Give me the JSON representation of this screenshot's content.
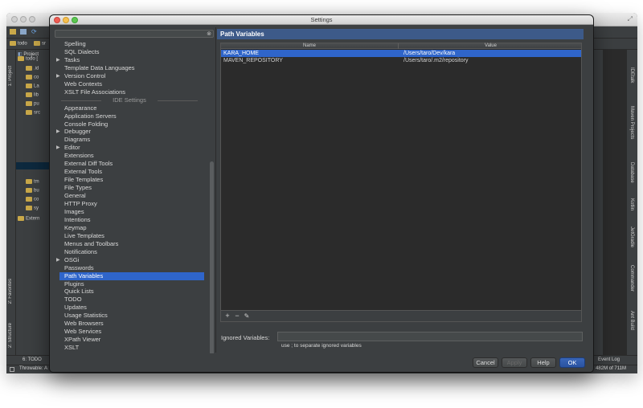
{
  "window": {
    "title": "Settings"
  },
  "search": {
    "placeholder": ""
  },
  "ide": {
    "project_tab": "Project",
    "todo_tab": "6: TODO",
    "status_text": "Throwable: A",
    "event_log": "Event Log",
    "memory": "482M of 711M",
    "tabs": [
      "todo",
      "sr"
    ],
    "left_tabs": [
      "1: Project",
      "2: Favorites",
      "2: Structure"
    ],
    "right_tabs": [
      "IDEtalk",
      "Maven Projects",
      "Database",
      "Kotlin",
      "JetGradle",
      "Commander",
      "Ant Build"
    ],
    "tree": [
      {
        "label": "todo [",
        "indent": 0
      },
      {
        "label": ".id",
        "indent": 1
      },
      {
        "label": "co",
        "indent": 1
      },
      {
        "label": "La",
        "indent": 1
      },
      {
        "label": "lib",
        "indent": 1
      },
      {
        "label": "pu",
        "indent": 1
      },
      {
        "label": "src",
        "indent": 1
      },
      {
        "label": "tm",
        "indent": 1
      },
      {
        "label": "bu",
        "indent": 1
      },
      {
        "label": "co",
        "indent": 1
      },
      {
        "label": "sy",
        "indent": 1
      },
      {
        "label": "Extern",
        "indent": 0
      }
    ]
  },
  "settings_tree": {
    "items": [
      {
        "label": "Spelling",
        "arrow": false
      },
      {
        "label": "SQL Dialects",
        "arrow": false
      },
      {
        "label": "Tasks",
        "arrow": true
      },
      {
        "label": "Template Data Languages",
        "arrow": false
      },
      {
        "label": "Version Control",
        "arrow": true
      },
      {
        "label": "Web Contexts",
        "arrow": false
      },
      {
        "label": "XSLT File Associations",
        "arrow": false
      }
    ],
    "ide_header": "IDE Settings",
    "ide_items": [
      {
        "label": "Appearance",
        "arrow": false
      },
      {
        "label": "Application Servers",
        "arrow": false
      },
      {
        "label": "Console Folding",
        "arrow": false
      },
      {
        "label": "Debugger",
        "arrow": true
      },
      {
        "label": "Diagrams",
        "arrow": false
      },
      {
        "label": "Editor",
        "arrow": true
      },
      {
        "label": "Extensions",
        "arrow": false
      },
      {
        "label": "External Diff Tools",
        "arrow": false
      },
      {
        "label": "External Tools",
        "arrow": false
      },
      {
        "label": "File Templates",
        "arrow": false
      },
      {
        "label": "File Types",
        "arrow": false
      },
      {
        "label": "General",
        "arrow": false
      },
      {
        "label": "HTTP Proxy",
        "arrow": false
      },
      {
        "label": "Images",
        "arrow": false
      },
      {
        "label": "Intentions",
        "arrow": false
      },
      {
        "label": "Keymap",
        "arrow": false
      },
      {
        "label": "Live Templates",
        "arrow": false
      },
      {
        "label": "Menus and Toolbars",
        "arrow": false
      },
      {
        "label": "Notifications",
        "arrow": false
      },
      {
        "label": "OSGi",
        "arrow": true
      },
      {
        "label": "Passwords",
        "arrow": false
      },
      {
        "label": "Path Variables",
        "arrow": false,
        "selected": true
      },
      {
        "label": "Plugins",
        "arrow": false
      },
      {
        "label": "Quick Lists",
        "arrow": false
      },
      {
        "label": "TODO",
        "arrow": false
      },
      {
        "label": "Updates",
        "arrow": false
      },
      {
        "label": "Usage Statistics",
        "arrow": false
      },
      {
        "label": "Web Browsers",
        "arrow": false
      },
      {
        "label": "Web Services",
        "arrow": false
      },
      {
        "label": "XPath Viewer",
        "arrow": false
      },
      {
        "label": "XSLT",
        "arrow": false
      }
    ]
  },
  "panel": {
    "title": "Path Variables",
    "columns": [
      "Name",
      "Value"
    ],
    "rows": [
      {
        "name": "KARA_HOME",
        "value": "/Users/taro/Dev/kara",
        "selected": true
      },
      {
        "name": "MAVEN_REPOSITORY",
        "value": "/Users/taro/.m2/repository",
        "selected": false
      }
    ],
    "tools": {
      "add": "+",
      "remove": "−",
      "edit": "✎"
    },
    "ignored_label": "Ignored Variables:",
    "ignored_value": "",
    "ignored_hint": "use ; to separate ignored variables"
  },
  "buttons": {
    "cancel": "Cancel",
    "apply": "Apply",
    "help": "Help",
    "ok": "OK"
  },
  "colors": {
    "selection": "#2f65ca",
    "panel_header": "#3d5a89",
    "background": "#3c3f41"
  }
}
